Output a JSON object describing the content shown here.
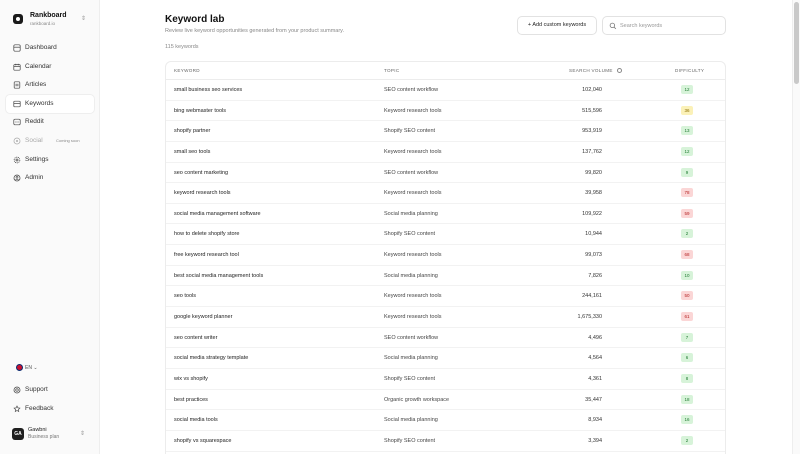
{
  "brand": {
    "name": "Rankboard",
    "url": "rankboard.io"
  },
  "sidebar": {
    "items": [
      {
        "label": "Dashboard",
        "icon": "dashboard-icon",
        "active": false,
        "disabled": false
      },
      {
        "label": "Calendar",
        "icon": "calendar-icon",
        "active": false,
        "disabled": false
      },
      {
        "label": "Articles",
        "icon": "articles-icon",
        "active": false,
        "disabled": false
      },
      {
        "label": "Keywords",
        "icon": "keywords-icon",
        "active": true,
        "disabled": false
      },
      {
        "label": "Reddit",
        "icon": "reddit-icon",
        "active": false,
        "disabled": false
      },
      {
        "label": "Social",
        "icon": "social-icon",
        "active": false,
        "disabled": true,
        "badge": "Coming soon"
      },
      {
        "label": "Settings",
        "icon": "settings-icon",
        "active": false,
        "disabled": false
      },
      {
        "label": "Admin",
        "icon": "admin-icon",
        "active": false,
        "disabled": false
      }
    ],
    "language": "EN",
    "bottom": [
      {
        "label": "Support",
        "icon": "support-icon"
      },
      {
        "label": "Feedback",
        "icon": "feedback-icon"
      }
    ]
  },
  "account": {
    "initials": "GA",
    "name": "Gawbni",
    "plan": "Business plan"
  },
  "header": {
    "title": "Keyword lab",
    "subtitle": "Review live keyword opportunities generated from your product summary.",
    "count": "115 keywords",
    "add_button": "Add custom keywords",
    "search_placeholder": "Search keywords"
  },
  "table": {
    "columns": {
      "keyword": "KEYWORD",
      "topic": "TOPIC",
      "volume": "SEARCH VOLUME",
      "difficulty": "DIFFICULTY"
    },
    "rows": [
      {
        "keyword": "small business seo services",
        "topic": "SEO content workflow",
        "volume": "102,040",
        "difficulty": "12",
        "level": "easy"
      },
      {
        "keyword": "bing webmaster tools",
        "topic": "Keyword research tools",
        "volume": "515,596",
        "difficulty": "36",
        "level": "med"
      },
      {
        "keyword": "shopify partner",
        "topic": "Shopify SEO content",
        "volume": "953,919",
        "difficulty": "13",
        "level": "easy"
      },
      {
        "keyword": "small seo tools",
        "topic": "Keyword research tools",
        "volume": "137,762",
        "difficulty": "12",
        "level": "easy"
      },
      {
        "keyword": "seo content marketing",
        "topic": "SEO content workflow",
        "volume": "99,820",
        "difficulty": "9",
        "level": "easy"
      },
      {
        "keyword": "keyword research tools",
        "topic": "Keyword research tools",
        "volume": "39,958",
        "difficulty": "78",
        "level": "hard"
      },
      {
        "keyword": "social media management software",
        "topic": "Social media planning",
        "volume": "109,922",
        "difficulty": "59",
        "level": "hard"
      },
      {
        "keyword": "how to delete shopify store",
        "topic": "Shopify SEO content",
        "volume": "10,944",
        "difficulty": "2",
        "level": "easy"
      },
      {
        "keyword": "free keyword research tool",
        "topic": "Keyword research tools",
        "volume": "99,073",
        "difficulty": "68",
        "level": "hard"
      },
      {
        "keyword": "best social media management tools",
        "topic": "Social media planning",
        "volume": "7,826",
        "difficulty": "10",
        "level": "easy"
      },
      {
        "keyword": "seo tools",
        "topic": "Keyword research tools",
        "volume": "244,161",
        "difficulty": "50",
        "level": "hard"
      },
      {
        "keyword": "google keyword planner",
        "topic": "Keyword research tools",
        "volume": "1,675,330",
        "difficulty": "61",
        "level": "hard"
      },
      {
        "keyword": "seo content writer",
        "topic": "SEO content workflow",
        "volume": "4,496",
        "difficulty": "7",
        "level": "easy"
      },
      {
        "keyword": "social media strategy template",
        "topic": "Social media planning",
        "volume": "4,564",
        "difficulty": "6",
        "level": "easy"
      },
      {
        "keyword": "wix vs shopify",
        "topic": "Shopify SEO content",
        "volume": "4,361",
        "difficulty": "8",
        "level": "easy"
      },
      {
        "keyword": "best practices",
        "topic": "Organic growth workspace",
        "volume": "35,447",
        "difficulty": "18",
        "level": "easy"
      },
      {
        "keyword": "social media tools",
        "topic": "Social media planning",
        "volume": "8,934",
        "difficulty": "16",
        "level": "easy"
      },
      {
        "keyword": "shopify vs squarespace",
        "topic": "Shopify SEO content",
        "volume": "3,394",
        "difficulty": "2",
        "level": "easy"
      }
    ]
  },
  "colors": {
    "easy": "#d7f3d9",
    "medium": "#fbf1b8",
    "hard": "#fbd6d6",
    "sidebar_bg": "#fafafa"
  }
}
